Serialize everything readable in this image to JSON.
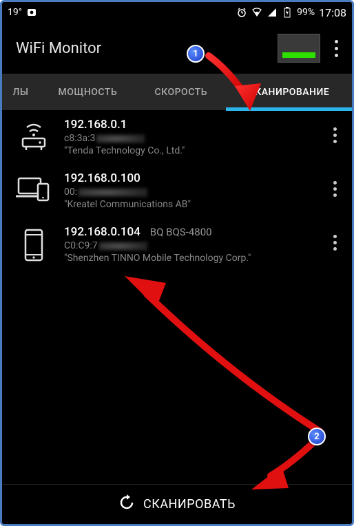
{
  "status": {
    "temp": "19°",
    "battery_pct": "99%",
    "time": "17:08"
  },
  "header": {
    "title": "WiFi Monitor"
  },
  "tabs": {
    "items": [
      {
        "label": "ЛЫ"
      },
      {
        "label": "МОЩНОСТЬ"
      },
      {
        "label": "СКОРОСТЬ"
      },
      {
        "label": "СКАНИРОВАНИЕ"
      }
    ]
  },
  "devices": [
    {
      "ip": "192.168.0.1",
      "mac_prefix": "c8:3a:3",
      "vendor": "\"Tenda Technology Co., Ltd.\"",
      "device_name": "",
      "icon": "router"
    },
    {
      "ip": "192.168.0.100",
      "mac_prefix": "00:",
      "vendor": "\"Kreatel Communications AB\"",
      "device_name": "",
      "icon": "laptop-phone"
    },
    {
      "ip": "192.168.0.104",
      "mac_prefix": "C0:C9:7",
      "vendor": "\"Shenzhen TINNO Mobile Technology Corp.\"",
      "device_name": "BQ BQS-4800",
      "icon": "phone"
    }
  ],
  "scan_button": {
    "label": "СКАНИРОВАТЬ"
  },
  "annotations": {
    "a1": "1",
    "a2": "2"
  }
}
